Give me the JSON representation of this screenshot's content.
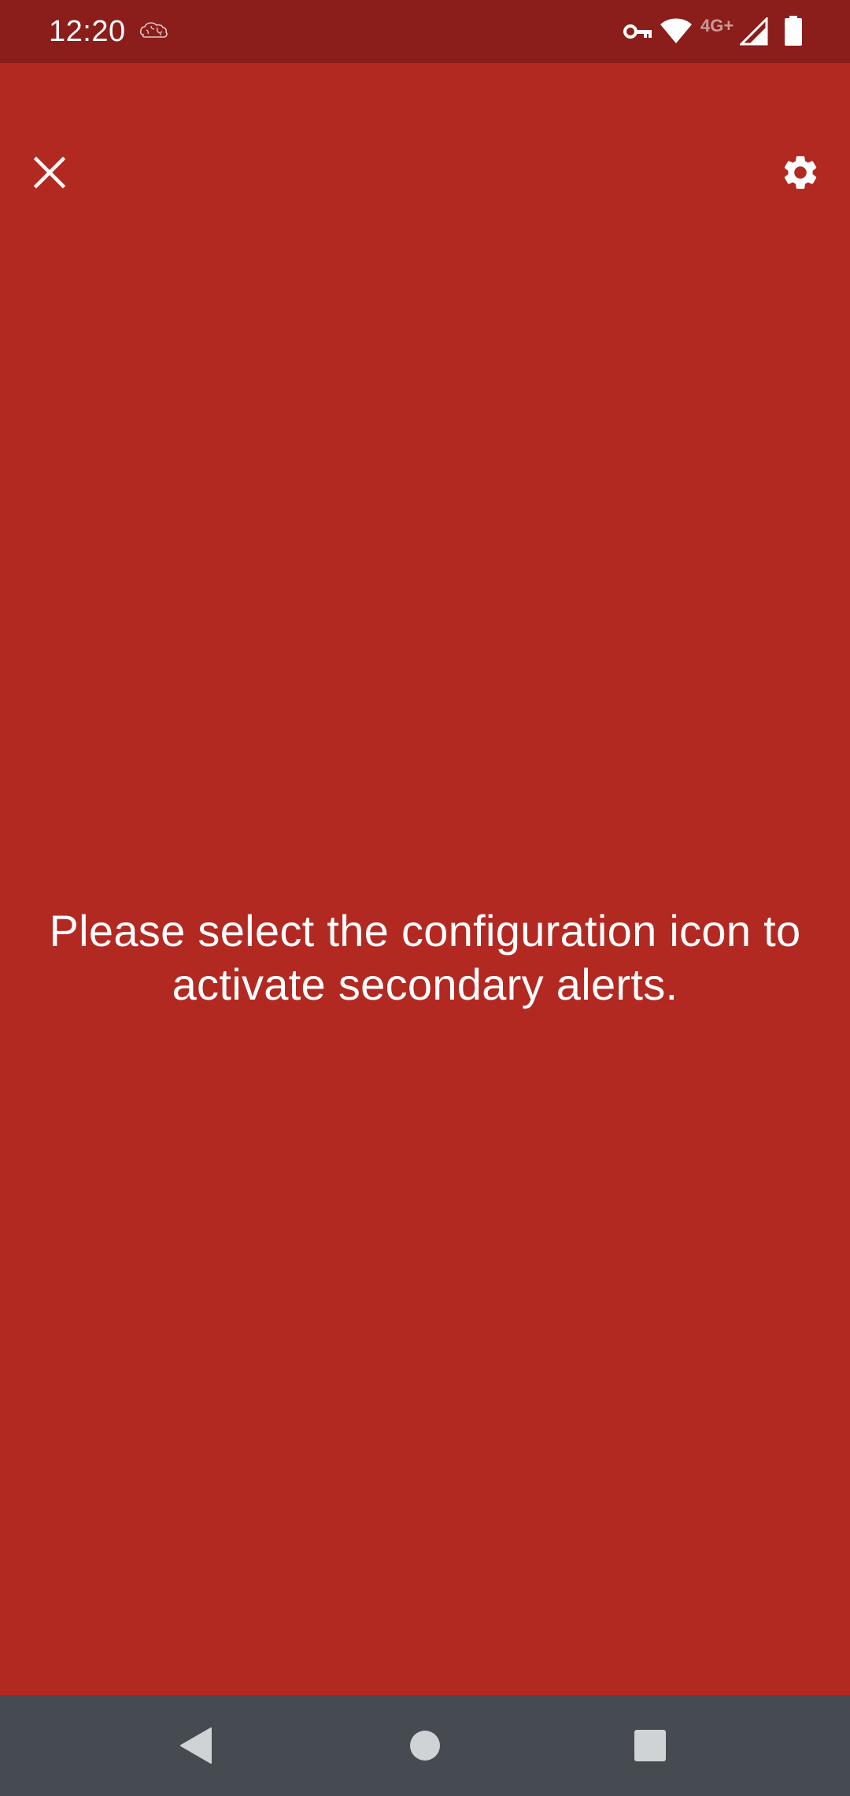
{
  "status_bar": {
    "time": "12:20",
    "network_label": "4G+",
    "icons": [
      "brain-notification-icon",
      "vpn-key-icon",
      "wifi-icon",
      "cell-signal-icon",
      "battery-icon"
    ]
  },
  "app_bar": {
    "close_icon": "close-icon",
    "settings_icon": "gear-icon"
  },
  "main": {
    "message": "Please select the configuration icon to activate secondary alerts."
  },
  "nav_bar": {
    "buttons": [
      "back-icon",
      "home-icon",
      "recents-icon"
    ]
  },
  "colors": {
    "background": "#B22922",
    "status_bar": "#8B1D1B",
    "nav_bar": "#454B50",
    "foreground": "#FFFFFF"
  }
}
